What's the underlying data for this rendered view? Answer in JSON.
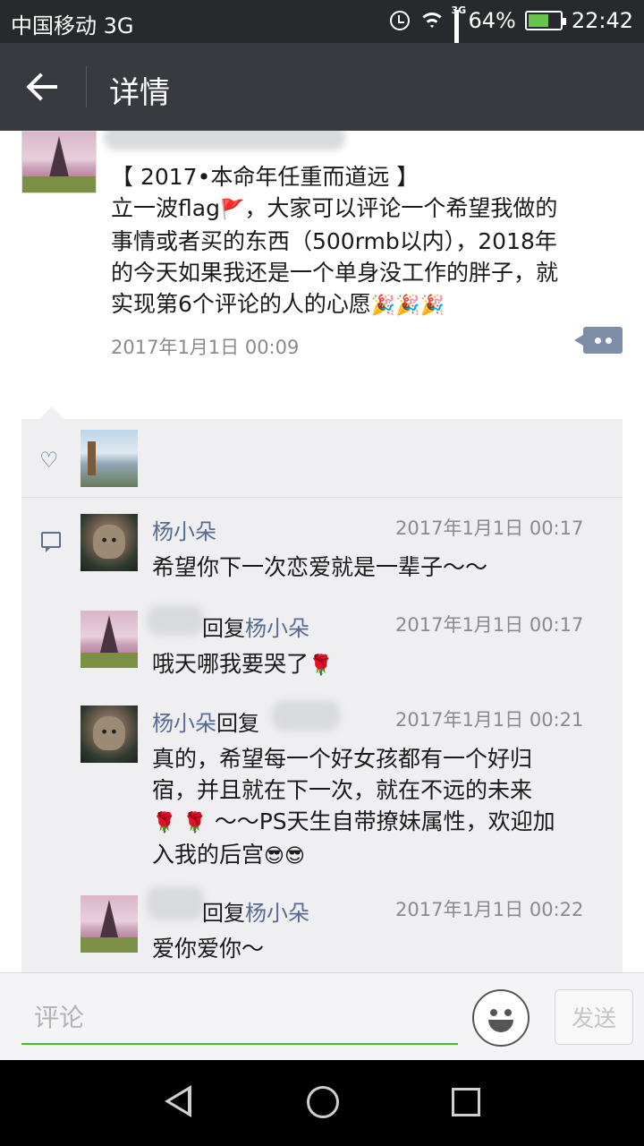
{
  "status_bar": {
    "carrier": "中国移动 3G",
    "network_tag": "3G",
    "battery": "64%",
    "battery_level": 0.64,
    "time": "22:42"
  },
  "header": {
    "title": "详情"
  },
  "post": {
    "lines": [
      "【 2017•本命年任重而道远 】",
      "立一波flag",
      "，大家可以评论一个希望我做的",
      "事情或者买的东西（500rmb以内），2018年",
      "的今天如果我还是一个单身没工作的胖子，就",
      "实现第6个评论的人的心愿"
    ],
    "emojis": {
      "flag": "🚩",
      "party": "🎉🎉🎉"
    },
    "time": "2017年1月1日 00:09"
  },
  "comments": [
    {
      "name": "杨小朵",
      "reply_word": "",
      "reply_to": "",
      "time": "2017年1月1日 00:17",
      "lines": [
        "希望你下一次恋爱就是一辈子～～"
      ]
    },
    {
      "name": "",
      "reply_word": "回复",
      "reply_to": "杨小朵",
      "time": "2017年1月1日 00:17",
      "lines": [
        "哦天哪我要哭了"
      ],
      "emoji": "🌹"
    },
    {
      "name": "杨小朵",
      "reply_word": "回复",
      "reply_to": "",
      "time": "2017年1月1日 00:21",
      "lines": [
        "真的，希望每一个好女孩都有一个好归",
        "宿，并且就在下一次，就在不远的未来",
        "～～PS天生自带撩妹属性，欢迎加",
        "入我的后宫"
      ],
      "emoji_roses": "🌹 🌹",
      "emoji_cool": "😎😎"
    },
    {
      "name": "",
      "reply_word": "回复",
      "reply_to": "杨小朵",
      "time": "2017年1月1日 00:22",
      "lines": [
        "爱你爱你～"
      ]
    }
  ],
  "input_bar": {
    "placeholder": "评论",
    "send_label": "发送"
  },
  "colors": {
    "status_bar": "#27292c",
    "title_bar": "#393a3f",
    "link_name": "#576b95",
    "input_underline": "#45c01a",
    "panel_bg": "#efeff1"
  },
  "icons": [
    "alarm-icon",
    "wifi-icon",
    "signal-icon",
    "battery-icon",
    "back-arrow-icon",
    "heart-icon",
    "comment-icon",
    "more-icon",
    "emoji-icon",
    "nav-back-icon",
    "nav-home-icon",
    "nav-recent-icon"
  ]
}
